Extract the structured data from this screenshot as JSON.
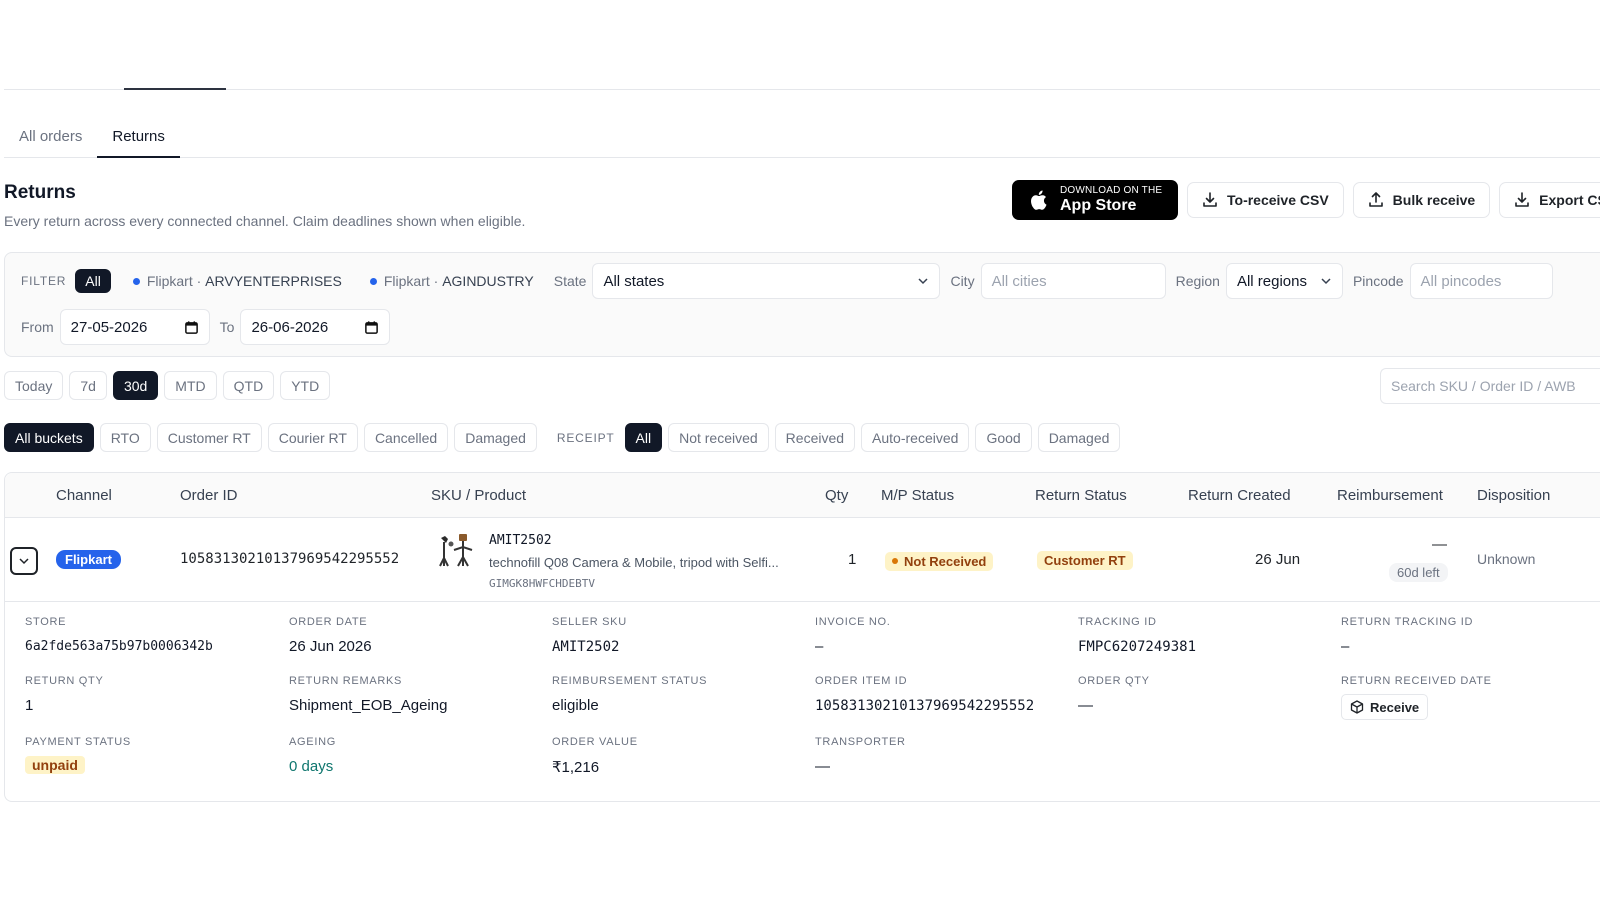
{
  "tabs": [
    {
      "label": "All orders"
    },
    {
      "label": "Returns"
    }
  ],
  "header": {
    "title": "Returns",
    "subtitle": "Every return across every connected channel. Claim deadlines shown when eligible."
  },
  "actions": {
    "appstore_small": "DOWNLOAD ON THE",
    "appstore_big": "App Store",
    "to_receive_csv": "To-receive CSV",
    "bulk_receive": "Bulk receive",
    "export_csv": "Export CSV"
  },
  "filter": {
    "label": "FILTER",
    "all": "All",
    "stores": [
      {
        "channel": "Flipkart",
        "sep": " · ",
        "name": "ARVYENTERPRISES"
      },
      {
        "channel": "Flipkart",
        "sep": " · ",
        "name": "AGINDUSTRY"
      }
    ],
    "state_label": "State",
    "state_value": "All states",
    "city_label": "City",
    "city_placeholder": "All cities",
    "region_label": "Region",
    "region_value": "All regions",
    "pincode_label": "Pincode",
    "pincode_placeholder": "All pincodes",
    "from_label": "From",
    "from_value": "27-05-2026",
    "to_label": "To",
    "to_value": "26-06-2026"
  },
  "periods": [
    {
      "label": "Today",
      "active": false
    },
    {
      "label": "7d",
      "active": false
    },
    {
      "label": "30d",
      "active": true
    },
    {
      "label": "MTD",
      "active": false
    },
    {
      "label": "QTD",
      "active": false
    },
    {
      "label": "YTD",
      "active": false
    }
  ],
  "search_placeholder": "Search SKU / Order ID / AWB",
  "buckets": [
    {
      "label": "All buckets",
      "active": true
    },
    {
      "label": "RTO",
      "active": false
    },
    {
      "label": "Customer RT",
      "active": false
    },
    {
      "label": "Courier RT",
      "active": false
    },
    {
      "label": "Cancelled",
      "active": false
    },
    {
      "label": "Damaged",
      "active": false
    }
  ],
  "receipt": {
    "label": "RECEIPT",
    "options": [
      {
        "label": "All",
        "active": true
      },
      {
        "label": "Not received",
        "active": false
      },
      {
        "label": "Received",
        "active": false
      },
      {
        "label": "Auto-received",
        "active": false
      },
      {
        "label": "Good",
        "active": false
      },
      {
        "label": "Damaged",
        "active": false
      }
    ]
  },
  "table": {
    "columns": {
      "channel": "Channel",
      "order_id": "Order ID",
      "sku": "SKU / Product",
      "qty": "Qty",
      "mp_status": "M/P Status",
      "return_status": "Return Status",
      "return_created": "Return Created",
      "reimbursement": "Reimbursement",
      "disposition": "Disposition"
    },
    "row": {
      "channel": "Flipkart",
      "order_id": "10583130210137969542295552",
      "sku": "AMIT2502",
      "product": "technofill Q08 Camera & Mobile, tripod with Selfi...",
      "fsn": "GIMGK8HWFCHDEBTV",
      "qty": "1",
      "mp_status": "Not Received",
      "return_status": "Customer RT",
      "return_created": "26 Jun",
      "reimbursement": "—",
      "days_left": "60d left",
      "disposition": "Unknown"
    },
    "details": {
      "store_k": "STORE",
      "store_v": "6a2fde563a75b97b0006342b",
      "order_date_k": "ORDER DATE",
      "order_date_v": "26 Jun 2026",
      "seller_sku_k": "SELLER SKU",
      "seller_sku_v": "AMIT2502",
      "invoice_k": "INVOICE NO.",
      "invoice_v": "–",
      "tracking_k": "TRACKING ID",
      "tracking_v": "FMPC6207249381",
      "return_tracking_k": "RETURN TRACKING ID",
      "return_tracking_v": "–",
      "return_qty_k": "RETURN QTY",
      "return_qty_v": "1",
      "return_remarks_k": "RETURN REMARKS",
      "return_remarks_v": "Shipment_EOB_Ageing",
      "reimb_status_k": "REIMBURSEMENT STATUS",
      "reimb_status_v": "eligible",
      "order_item_k": "ORDER ITEM ID",
      "order_item_v": "10583130210137969542295552",
      "order_qty_k": "ORDER QTY",
      "order_qty_v": "—",
      "return_received_k": "RETURN RECEIVED DATE",
      "receive_btn": "Receive",
      "payment_k": "PAYMENT STATUS",
      "payment_v": "unpaid",
      "ageing_k": "AGEING",
      "ageing_v": "0 days",
      "order_value_k": "ORDER VALUE",
      "order_value_v": "₹1,216",
      "transporter_k": "TRANSPORTER",
      "transporter_v": "—"
    }
  }
}
